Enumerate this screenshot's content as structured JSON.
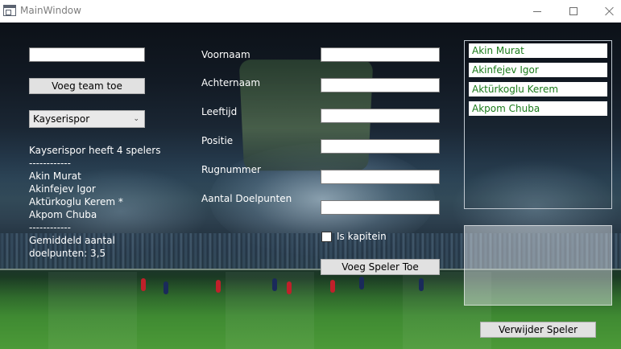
{
  "window": {
    "title": "MainWindow"
  },
  "team": {
    "name_input_value": "",
    "add_team_button": "Voeg team toe",
    "selected_team": "Kayserispor",
    "summary": {
      "header": "Kayserispor heeft 4 spelers",
      "separator_top": "------------",
      "players": [
        "Akin Murat",
        "Akinfejev Igor",
        "Aktürkoglu Kerem *",
        "Akpom Chuba"
      ],
      "separator_bottom": "------------",
      "average_line1": "Gemiddeld aantal",
      "average_line2": "doelpunten: 3,5"
    }
  },
  "form": {
    "voornaam_label": "Voornaam",
    "achternaam_label": "Achternaam",
    "leeftijd_label": "Leeftijd",
    "positie_label": "Positie",
    "rugnummer_label": "Rugnummer",
    "doelpunten_label": "Aantal Doelpunten",
    "kapitein_label": "Is kapitein",
    "kapitein_checked": false,
    "add_player_button": "Voeg Speler Toe",
    "values": {
      "voornaam": "",
      "achternaam": "",
      "leeftijd": "",
      "positie": "",
      "rugnummer": "",
      "doelpunten": ""
    }
  },
  "players_list": [
    "Akin Murat",
    "Akinfejev Igor",
    "Aktürkoglu Kerem",
    "Akpom Chuba"
  ],
  "remove_player_button": "Verwijder Speler",
  "colors": {
    "list_text": "#1a7a1a",
    "button_bg": "#e1e1e1",
    "label_text": "#ffffff"
  }
}
